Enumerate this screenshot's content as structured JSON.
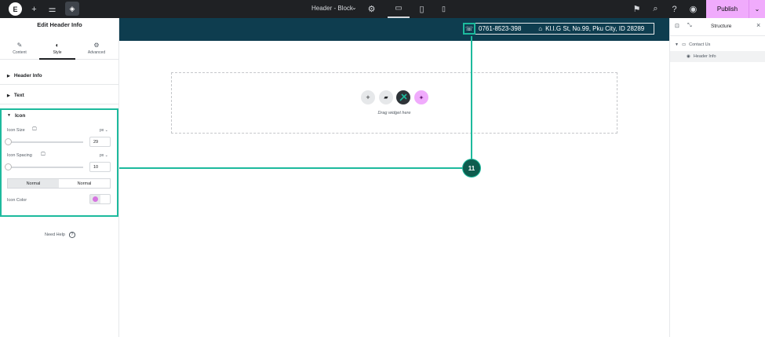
{
  "topbar": {
    "logo": "E",
    "add_icon": "+",
    "settings_icon": "⚌",
    "layers_icon": "◈",
    "doc_title": "Header - Block",
    "doc_chevron": "⌄",
    "doc_settings_icon": "⚙",
    "device_desktop_icon": "▭",
    "device_tablet_icon": "▯",
    "device_mobile_icon": "▯",
    "notifications_icon": "⚑",
    "search_icon": "⌕",
    "help_icon": "?",
    "preview_icon": "◉",
    "publish_label": "Publish",
    "publish_chevron": "⌄"
  },
  "left_panel": {
    "title": "Edit Header Info",
    "tabs": [
      {
        "label": "Content",
        "icon": "✎"
      },
      {
        "label": "Style",
        "icon": "◐"
      },
      {
        "label": "Advanced",
        "icon": "⚙"
      }
    ],
    "sections": {
      "header_info": "Header Info",
      "text": "Text",
      "icon": "Icon"
    },
    "icon_size": {
      "label": "Icon Size",
      "unit": "px ⌄",
      "value": "29"
    },
    "icon_spacing": {
      "label": "Icon Spacing",
      "unit": "px ⌄",
      "value": "10"
    },
    "state_toggle": [
      "Normal",
      "Normal"
    ],
    "icon_color_label": "Icon Color",
    "icon_color": "#d675e0",
    "need_help": "Need Help",
    "need_help_icon": "?"
  },
  "canvas": {
    "phone_icon": "☏",
    "phone": "0761-8523-398",
    "address_icon": "⌂",
    "address": "Kl.I.G St, No.99, Pku City, ID 28289",
    "drop_text": "Drag widget here",
    "drop_buttons": {
      "add": "+",
      "folder": "▰",
      "ai": "✦"
    },
    "marker": "11",
    "accent": "#1dba9d",
    "header_bg": "#0e3d4f"
  },
  "right_panel": {
    "title": "Structure",
    "close": "×",
    "items": [
      "Contact Us",
      "Header Info"
    ]
  }
}
